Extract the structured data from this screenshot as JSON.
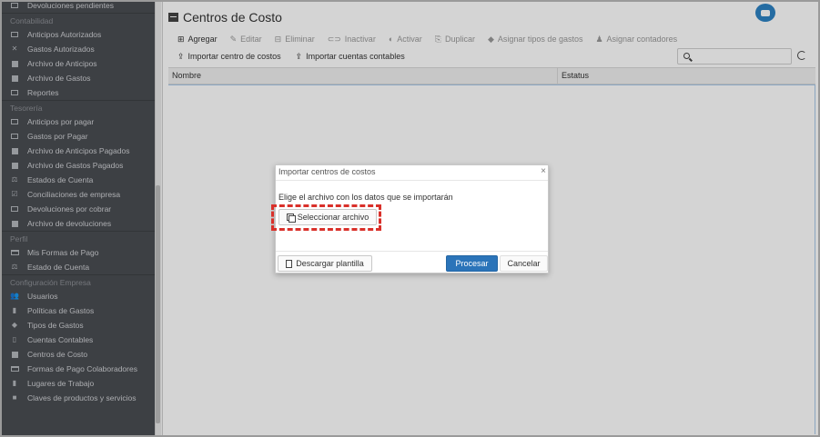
{
  "sidebar": {
    "top_item": "Devoluciones pendientes",
    "sections": [
      {
        "title": "Contabilidad",
        "items": [
          {
            "label": "Anticipos Autorizados",
            "icon": "card-icon"
          },
          {
            "label": "Gastos Autorizados",
            "icon": "cross-icon"
          },
          {
            "label": "Archivo de Anticipos",
            "icon": "archive-icon"
          },
          {
            "label": "Archivo de Gastos",
            "icon": "archive-icon"
          },
          {
            "label": "Reportes",
            "icon": "table-icon"
          }
        ]
      },
      {
        "title": "Tesorería",
        "items": [
          {
            "label": "Anticipos por pagar",
            "icon": "card-icon"
          },
          {
            "label": "Gastos por Pagar",
            "icon": "card-icon"
          },
          {
            "label": "Archivo de Anticipos Pagados",
            "icon": "archive-icon"
          },
          {
            "label": "Archivo de Gastos Pagados",
            "icon": "archive-icon"
          },
          {
            "label": "Estados de Cuenta",
            "icon": "balance-icon"
          },
          {
            "label": "Conciliaciones de empresa",
            "icon": "check-icon"
          },
          {
            "label": "Devoluciones por cobrar",
            "icon": "card-icon"
          },
          {
            "label": "Archivo de devoluciones",
            "icon": "archive-icon"
          }
        ]
      },
      {
        "title": "Perfil",
        "items": [
          {
            "label": "Mis Formas de Pago",
            "icon": "credit-card-icon"
          },
          {
            "label": "Estado de Cuenta",
            "icon": "balance-icon"
          }
        ]
      },
      {
        "title": "Configuración Empresa",
        "items": [
          {
            "label": "Usuarios",
            "icon": "users-icon"
          },
          {
            "label": "Políticas de Gastos",
            "icon": "book-icon"
          },
          {
            "label": "Tipos de Gastos",
            "icon": "tag-icon"
          },
          {
            "label": "Cuentas Contables",
            "icon": "ledger-icon"
          },
          {
            "label": "Centros de Costo",
            "icon": "archive-icon"
          },
          {
            "label": "Formas de Pago Colaboradores",
            "icon": "credit-card-icon"
          },
          {
            "label": "Lugares de Trabajo",
            "icon": "building-icon"
          },
          {
            "label": "Claves de productos y servicios",
            "icon": "briefcase-icon"
          }
        ]
      }
    ]
  },
  "main": {
    "title": "Centros de Costo",
    "toolbar": [
      {
        "label": "Agregar",
        "icon": "⊞",
        "enabled": true
      },
      {
        "label": "Editar",
        "icon": "✎",
        "enabled": false
      },
      {
        "label": "Eliminar",
        "icon": "⊟",
        "enabled": false
      },
      {
        "label": "Inactivar",
        "icon": "⊂⊃",
        "enabled": false
      },
      {
        "label": "Activar",
        "icon": "◐",
        "enabled": false
      },
      {
        "label": "Duplicar",
        "icon": "⎘",
        "enabled": false
      },
      {
        "label": "Asignar tipos de gastos",
        "icon": "◆",
        "enabled": false
      },
      {
        "label": "Asignar contadores",
        "icon": "♟",
        "enabled": false
      }
    ],
    "toolbar2": [
      {
        "label": "Importar centro de costos",
        "icon": "⇪"
      },
      {
        "label": "Importar cuentas contables",
        "icon": "⇪"
      }
    ],
    "search": {
      "value": "",
      "placeholder": ""
    },
    "table": {
      "columns": [
        "Nombre",
        "Estatus"
      ]
    }
  },
  "dialog": {
    "title": "Importar centros de costos",
    "close": "×",
    "message": "Elige el archivo con los datos que se importarán",
    "select_button": "Seleccionar archivo",
    "template_button": "Descargar plantilla",
    "process_button": "Procesar",
    "cancel_button": "Cancelar"
  },
  "colors": {
    "sidebar_bg": "#4a4d52",
    "primary": "#2b74b9",
    "highlight": "#d9302a",
    "chat": "#2d82c3"
  }
}
